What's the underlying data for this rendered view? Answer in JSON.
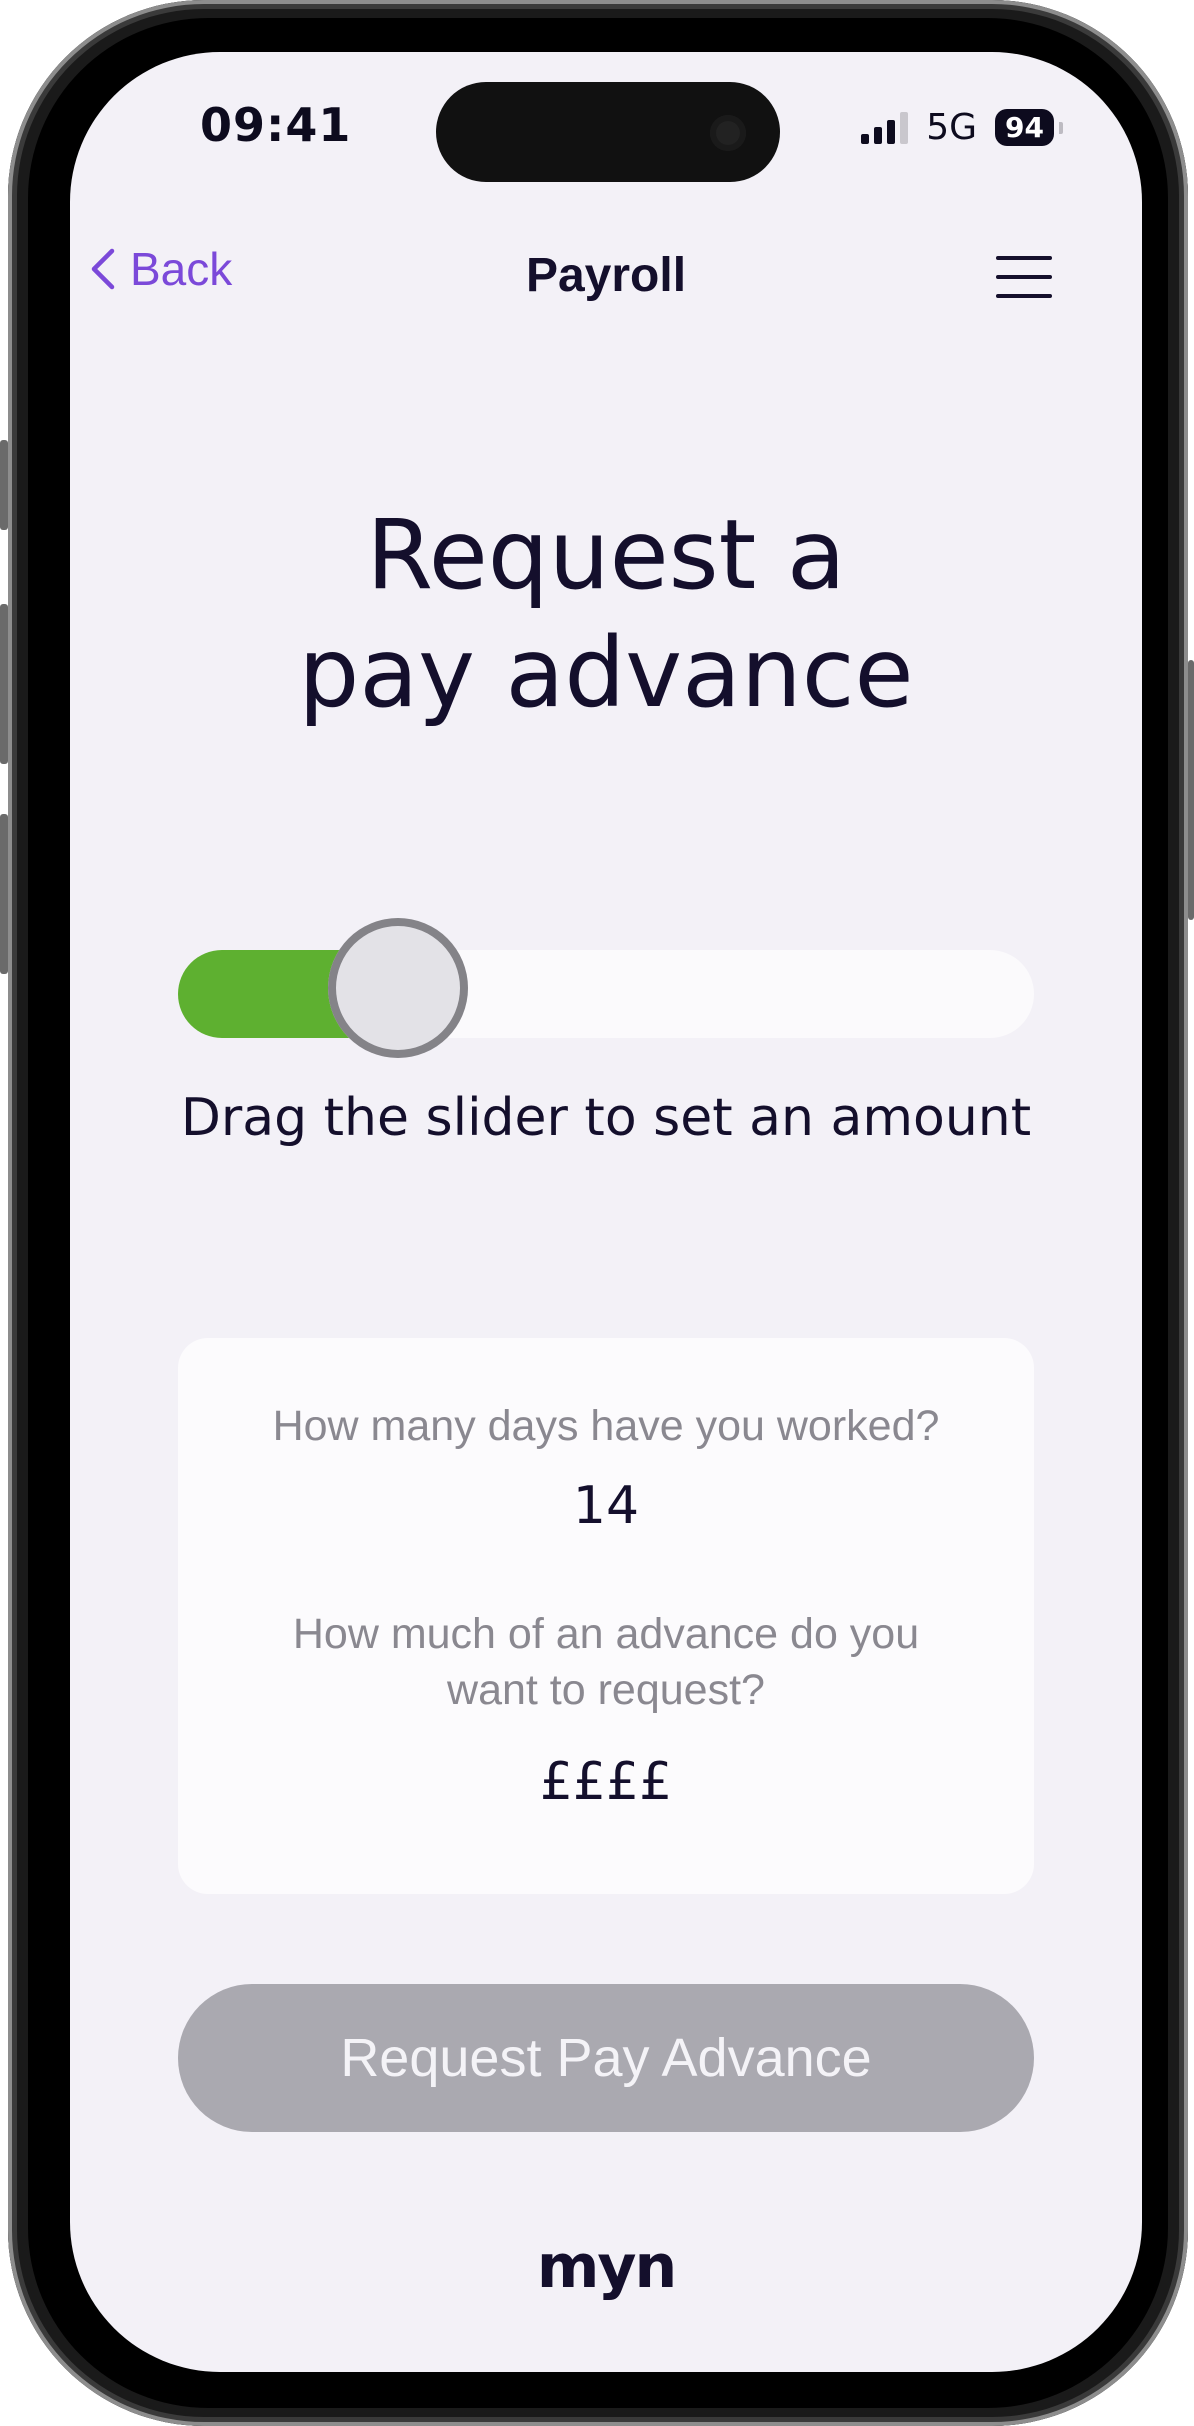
{
  "status_bar": {
    "time": "09:41",
    "network": "5G",
    "battery": "94",
    "signal_bars_active": 3,
    "signal_bars_total": 4
  },
  "nav": {
    "back_label": "Back",
    "title": "Payroll",
    "menu_icon": "hamburger-icon"
  },
  "headline": {
    "line1": "Request a",
    "line2": "pay advance"
  },
  "slider": {
    "value_fraction": 0.21,
    "hint": "Drag the slider to set an amount",
    "fill_color": "#5eb030"
  },
  "card": {
    "days_question": "How many days have you worked?",
    "days_value": "14",
    "amount_question_line1": "How much of an advance do you",
    "amount_question_line2": "want to request?",
    "amount_value": "££££"
  },
  "cta": {
    "label": "Request Pay Advance",
    "state": "disabled"
  },
  "footer": {
    "logo_text": "myn"
  },
  "colors": {
    "accent": "#7b49d9",
    "text_dark": "#140f2c",
    "background": "#f3f1f7"
  }
}
